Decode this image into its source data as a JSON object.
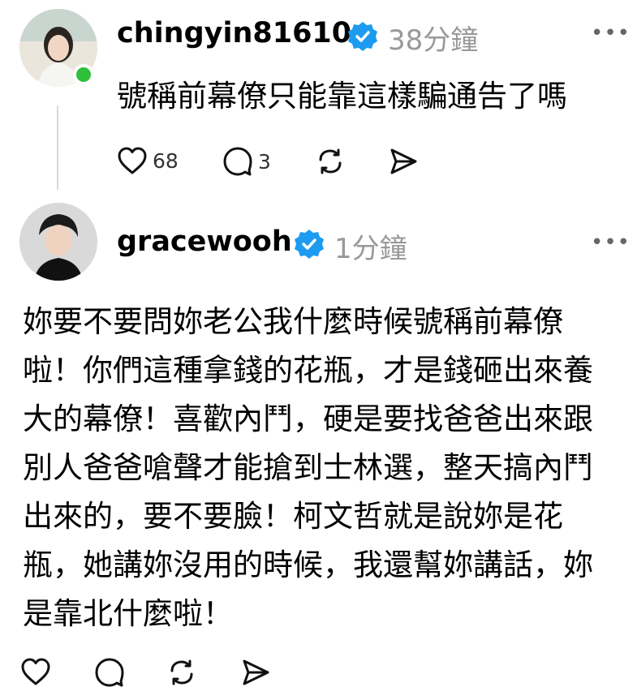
{
  "posts": [
    {
      "username": "chingyin81610",
      "time": "38分鐘",
      "text": "號稱前幕僚只能靠這樣騙通告了嗎",
      "likes": "68",
      "comments": "3",
      "online": true
    },
    {
      "username": "gracewooh",
      "time": "1分鐘",
      "text": "妳要不要問妳老公我什麼時候號稱前幕僚啦！你們這種拿錢的花瓶，才是錢砸出來養大的幕僚！喜歡內鬥，硬是要找爸爸出來跟別人爸爸嗆聲才能搶到士林選，整天搞內鬥出來的，要不要臉！柯文哲就是說妳是花瓶，她講妳沒用的時候，我還幫妳講話，妳是靠北什麼啦！"
    }
  ],
  "more_label": "•••",
  "colors": {
    "verified": "#1d9bf0",
    "online": "#2fbf3a",
    "muted": "#999999"
  }
}
